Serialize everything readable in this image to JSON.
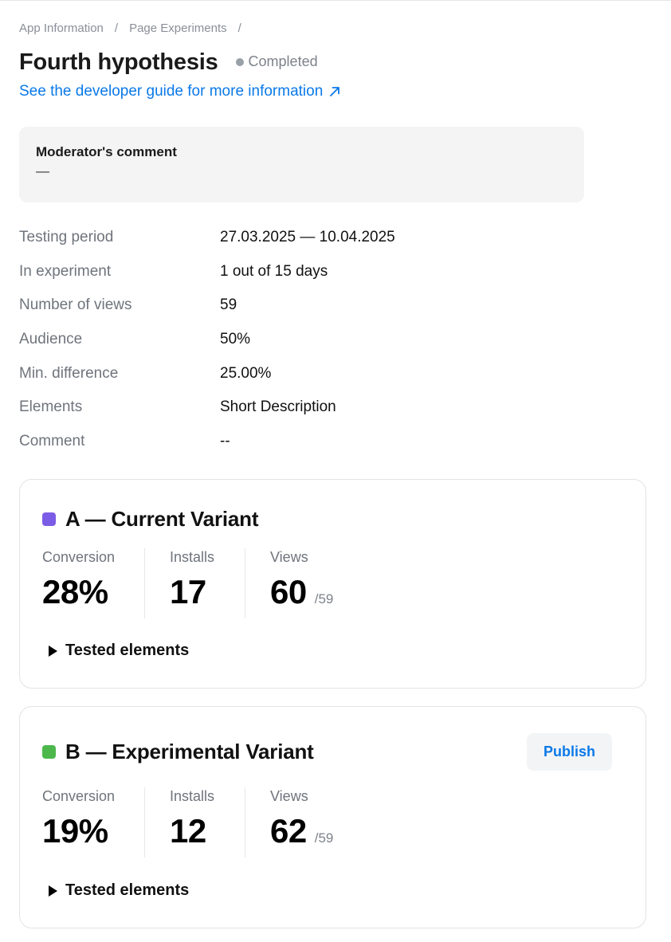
{
  "breadcrumb": {
    "items": [
      "App Information",
      "Page Experiments"
    ],
    "separator": "/"
  },
  "header": {
    "title": "Fourth hypothesis",
    "status": "Completed",
    "status_color": "#9aa0a8",
    "guide_link": "See the developer guide for more information",
    "guide_link_icon": "external-arrow-icon",
    "link_color": "#0a79e8"
  },
  "moderator": {
    "title": "Moderator's comment",
    "value": "—"
  },
  "details": [
    {
      "label": "Testing period",
      "value": "27.03.2025 — 10.04.2025"
    },
    {
      "label": "In experiment",
      "value": "1 out of 15 days"
    },
    {
      "label": "Number of views",
      "value": "59"
    },
    {
      "label": "Audience",
      "value": "50%"
    },
    {
      "label": "Min. difference",
      "value": "25.00%"
    },
    {
      "label": "Elements",
      "value": "Short Description"
    },
    {
      "label": "Comment",
      "value": "--"
    }
  ],
  "variants": [
    {
      "title": "A — Current Variant",
      "color": "#7b5ce6",
      "metrics": [
        {
          "label": "Conversion",
          "value": "28%",
          "suffix": ""
        },
        {
          "label": "Installs",
          "value": "17",
          "suffix": ""
        },
        {
          "label": "Views",
          "value": "60",
          "suffix": "/59"
        }
      ],
      "tested_label": "Tested elements"
    },
    {
      "title": "B — Experimental Variant",
      "color": "#4cb84c",
      "publish_label": "Publish",
      "metrics": [
        {
          "label": "Conversion",
          "value": "19%",
          "suffix": ""
        },
        {
          "label": "Installs",
          "value": "12",
          "suffix": ""
        },
        {
          "label": "Views",
          "value": "62",
          "suffix": "/59"
        }
      ],
      "tested_label": "Tested elements"
    }
  ]
}
